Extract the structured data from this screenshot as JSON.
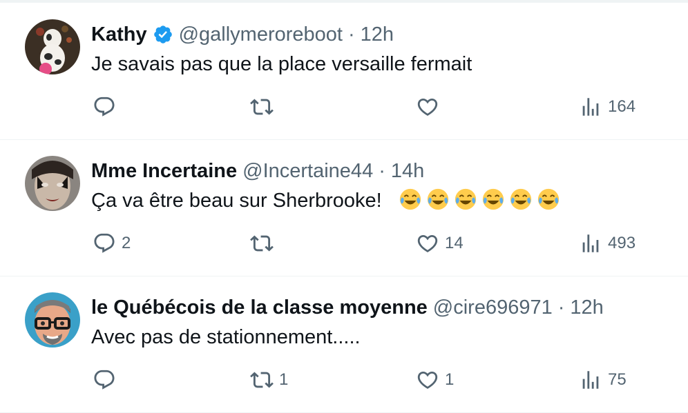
{
  "tweets": [
    {
      "name": "Kathy",
      "verified": true,
      "handle": "@gallymeroreboot",
      "separator": "·",
      "time": "12h",
      "text": "Je savais pas que la place versaille fermait",
      "emoji": [],
      "replies": "",
      "retweets": "",
      "likes": "",
      "views": "164"
    },
    {
      "name": "Mme Incertaine",
      "verified": false,
      "handle": "@Incertaine44",
      "separator": "·",
      "time": "14h",
      "text": "Ça va être beau sur Sherbrooke!",
      "emoji": [
        "face-with-tears-of-joy",
        "face-with-tears-of-joy",
        "face-with-tears-of-joy",
        "face-with-tears-of-joy",
        "face-with-tears-of-joy",
        "face-with-tears-of-joy"
      ],
      "replies": "2",
      "retweets": "",
      "likes": "14",
      "views": "493"
    },
    {
      "name": "le Québécois de la classe moyenne",
      "verified": false,
      "handle": "@cire696971",
      "separator": "·",
      "time": "12h",
      "text": "Avec pas de stationnement.....",
      "emoji": [],
      "replies": "",
      "retweets": "1",
      "likes": "1",
      "views": "75"
    }
  ],
  "colors": {
    "text_primary": "#0f1419",
    "text_secondary": "#536471",
    "divider": "#eff3f4",
    "verified_blue": "#1d9bf0"
  },
  "icons": [
    "reply-icon",
    "retweet-icon",
    "like-icon",
    "views-icon",
    "verified-badge-icon"
  ]
}
